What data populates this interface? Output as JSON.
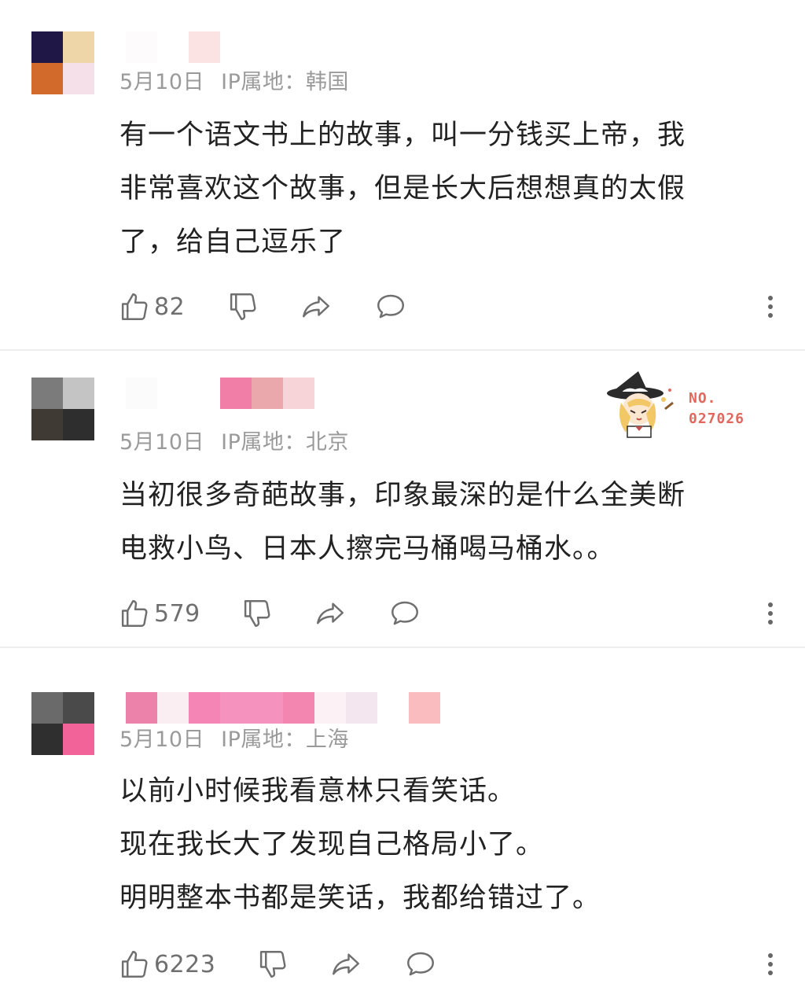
{
  "comments": [
    {
      "date": "5月10日",
      "ip_label": "IP属地：",
      "ip_location": "韩国",
      "lines": [
        "有一个语文书上的故事，叫一分钱买上帝，我",
        "非常喜欢这个故事，但是长大后想想真的太假",
        "了，给自己逗乐了"
      ],
      "likes": "82",
      "avatar_colors": [
        "#1f1745",
        "#efd6a8",
        "#d26a2c",
        "#f5e0ea"
      ],
      "name_colors": [
        "#fdfbfb",
        "#fbe3e3"
      ]
    },
    {
      "date": "5月10日",
      "ip_label": "IP属地：",
      "ip_location": "北京",
      "lines": [
        "当初很多奇葩故事，印象最深的是什么全美断",
        "电救小鸟、日本人擦完马桶喝马桶水。。"
      ],
      "likes": "579",
      "avatar_colors": [
        "#7b7b7b",
        "#c4c4c4",
        "#3f3a33",
        "#2e2e2e"
      ],
      "name_colors": [
        "#fbfbfb",
        "#f07ea6",
        "#eaa8ad",
        "#f7d4d8"
      ],
      "badge": {
        "line1": "NO.",
        "line2": "027026"
      }
    },
    {
      "date": "5月10日",
      "ip_label": "IP属地：",
      "ip_location": "上海",
      "lines": [
        "以前小时候我看意林只看笑话。",
        "现在我长大了发现自己格局小了。",
        "明明整本书都是笑话，我都给错过了。"
      ],
      "likes": "6223",
      "avatar_colors": [
        "#6a6a6a",
        "#4a4a4a",
        "#2f2f2f",
        "#f2639a"
      ],
      "name_colors": [
        "#ec81a9",
        "#fbeef3",
        "#f585b5",
        "#f592bd",
        "#f286b1",
        "#fcf2f6",
        "#f3e6ee",
        "#fbbcc0"
      ]
    }
  ],
  "icons": {
    "like": "thumbs-up-icon",
    "dislike": "thumbs-down-icon",
    "share": "share-arrow-icon",
    "reply": "comment-bubble-icon",
    "more": "more-vertical-icon"
  },
  "colors": {
    "meta_text": "#9a9a9a",
    "body_text": "#222222",
    "icon": "#6f6f6f",
    "badge": "#e2685e",
    "divider": "#eeeeee"
  }
}
